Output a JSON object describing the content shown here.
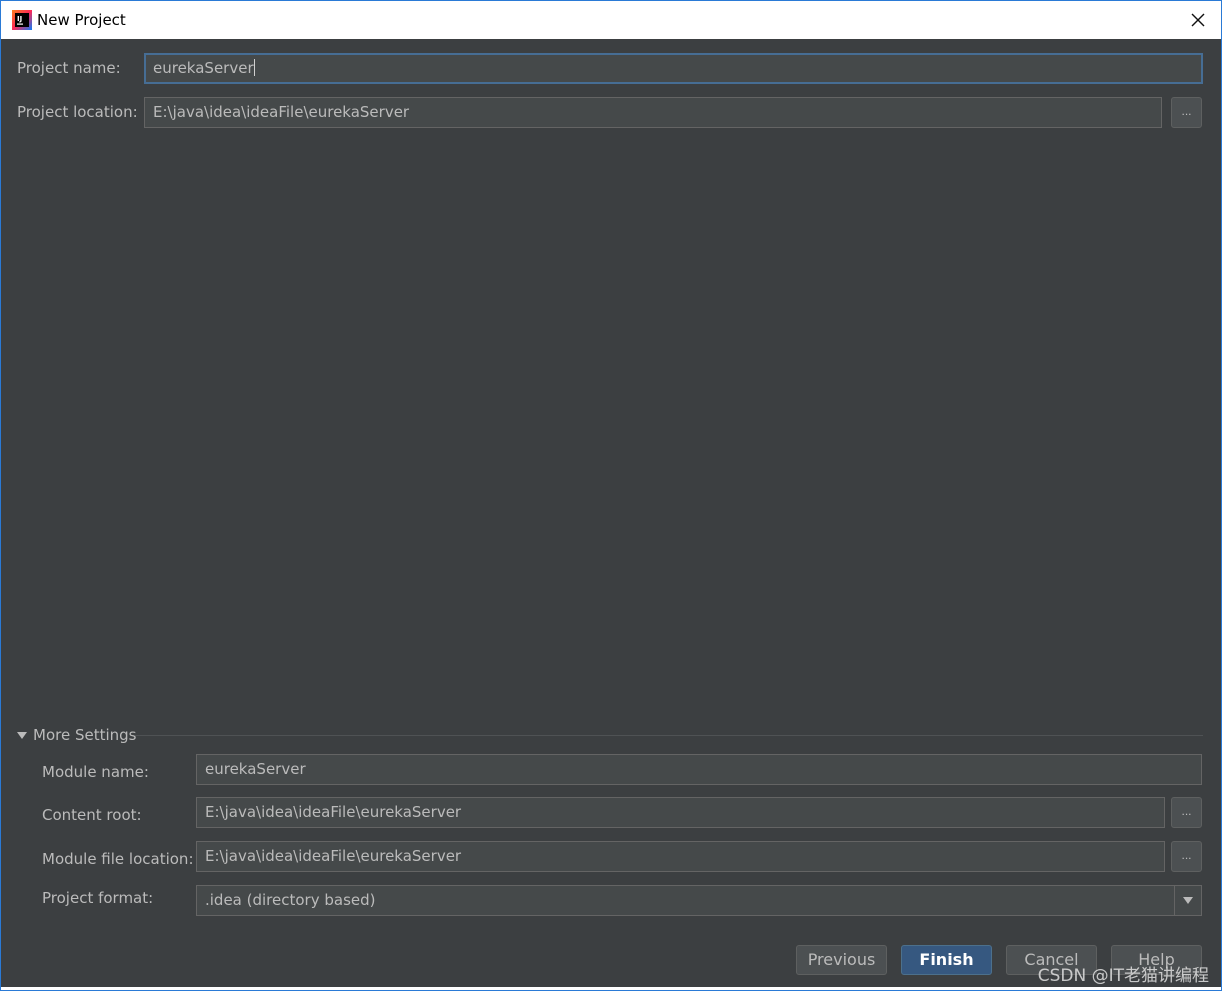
{
  "window": {
    "title": "New Project",
    "close_glyph": "✕"
  },
  "project": {
    "name_label": "Project name:",
    "name_value": "eurekaServer",
    "location_label": "Project location:",
    "location_value": "E:\\java\\idea\\ideaFile\\eurekaServer",
    "browse_glyph": "..."
  },
  "more_settings": {
    "title": "More Settings",
    "module_name_label": "Module name:",
    "module_name_value": "eurekaServer",
    "content_root_label": "Content root:",
    "content_root_value": "E:\\java\\idea\\ideaFile\\eurekaServer",
    "module_file_location_label": "Module file location:",
    "module_file_location_value": "E:\\java\\idea\\ideaFile\\eurekaServer",
    "project_format_label": "Project format:",
    "project_format_value": ".idea (directory based)"
  },
  "buttons": {
    "previous": "Previous",
    "finish": "Finish",
    "cancel": "Cancel",
    "help": "Help"
  },
  "watermark": "CSDN @IT老猫讲编程",
  "icons": {
    "app": "intellij-idea-icon",
    "close": "close-icon",
    "expand": "triangle-down-icon",
    "dropdown": "chevron-down-icon"
  },
  "colors": {
    "background": "#3c3f41",
    "field": "#45494a",
    "focus_border": "#466d94",
    "primary_button": "#365880"
  }
}
